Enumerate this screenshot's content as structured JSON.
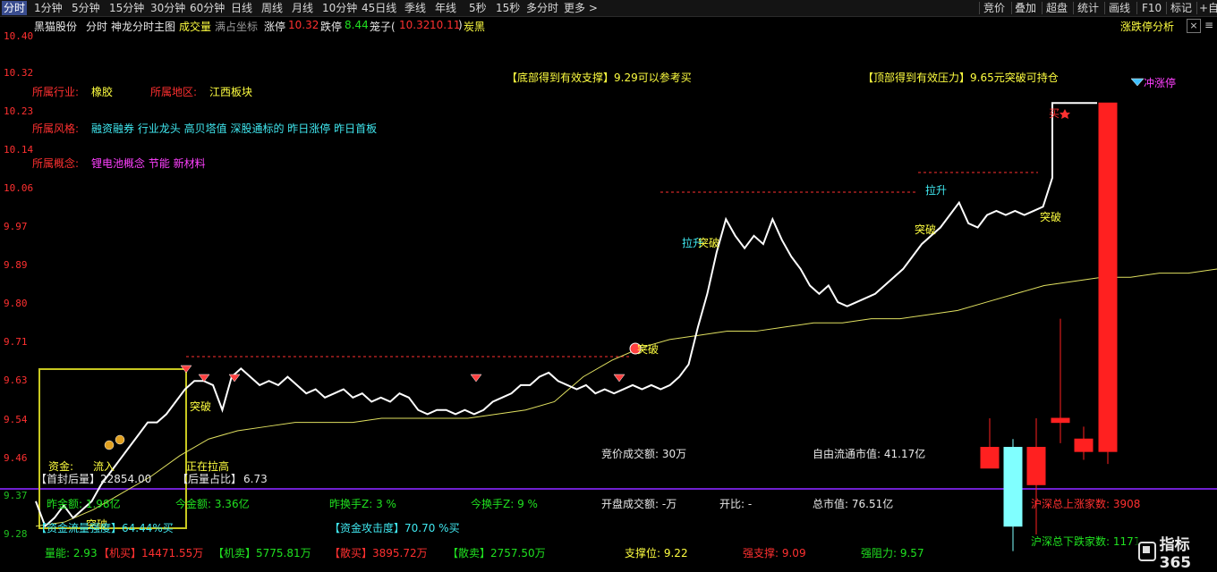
{
  "toolbar": {
    "timeframes": [
      "分时",
      "1分钟",
      "5分钟",
      "15分钟",
      "30分钟",
      "60分钟",
      "日线",
      "周线",
      "月线",
      "10分钟",
      "45日线",
      "季线",
      "年线",
      "5秒",
      "15秒",
      "多分时",
      "更多 >"
    ],
    "right_buttons": [
      "竞价",
      "叠加",
      "超盘",
      "统计",
      "画线",
      "F10",
      "标记",
      "+自"
    ]
  },
  "info": {
    "stock_name": "黑猫股份",
    "view": "分时",
    "indicator": "神龙分时主图",
    "volume": "成交量",
    "full_coord": "满占坐标",
    "limit_up_label": "涨停",
    "limit_up_value": "10.32",
    "limit_down_label": "跌停",
    "limit_down_value": "8.44",
    "cage_label": "笼子(",
    "cage_high": "10.32",
    "cage_low": "10.11",
    "cage_close": ")",
    "sector": "炭黑",
    "analysis_button": "涨跌停分析",
    "close_icon": "×",
    "menu_icon": "≡"
  },
  "axis": {
    "prices": [
      "10.40",
      "10.32",
      "10.23",
      "10.14",
      "10.06",
      "9.97",
      "9.89",
      "9.80",
      "9.71",
      "9.63",
      "9.54",
      "9.46",
      "9.37",
      "9.28"
    ]
  },
  "profile": {
    "industry_label": "所属行业:",
    "industry": "橡胶",
    "region_label": "所属地区:",
    "region": "江西板块",
    "style_label": "所属风格:",
    "style": "融资融券 行业龙头 高贝塔值 深股通标的 昨日涨停 昨日首板",
    "concept_label": "所属概念:",
    "concept": "锂电池概念 节能 新材料"
  },
  "annotations": {
    "support": "【底部得到有效支撑】9.29可以参考买",
    "resistance": "【顶部得到有效压力】9.65元突破可持仓",
    "limit_up": "冲涨停",
    "breakthrough": "突破",
    "pull_up": "拉升",
    "buy_mark": "买",
    "fund_label": "资金:",
    "fund_flow": "流入",
    "rising": "正在拉高"
  },
  "stats": {
    "first_seal": "【首封后量】22854.00",
    "after_ratio_label": "【后量占比】",
    "after_ratio": "6.73",
    "auction_amount": "竞价成交额: 30万",
    "float_mv": "自由流通市值: 41.17亿",
    "prev_amount": "昨金额: 1.98亿",
    "today_amount": "今金额: 3.36亿",
    "prev_turnover": "昨换手Z: 3 %",
    "today_turnover": "今换手Z: 9 %",
    "open_amount": "开盘成交额: -万",
    "open_ratio": "开比: -",
    "total_mv": "总市值: 76.51亿",
    "limit_up_count": "沪深总上涨家数: 3908",
    "fund_inflow": "【资金流量强度】64.44%买",
    "fund_attack": "【资金攻击度】70.70 %买",
    "limit_down_count": "沪深总下跌家数: 1171",
    "volume_ratio": "量能: 2.93",
    "inst_buy": "【机买】14471.55万",
    "inst_sell": "【机卖】5775.81万",
    "retail_buy": "【散买】3895.72万",
    "retail_sell": "【散卖】2757.50万",
    "support_level": "支撑位: 9.22",
    "strong_support": "强支撑: 9.09",
    "strong_resist": "强阻力: 9.57"
  },
  "footer": {
    "brand": "指标365"
  },
  "colors": {
    "up": "#ff3030",
    "down": "#20c020",
    "price_line": "#ffffff",
    "avg_line": "#e0e060",
    "box": "#c8c820",
    "purple_line": "#7020d0"
  },
  "chart_data": {
    "type": "line",
    "ylim": [
      9.28,
      10.4
    ],
    "series": [
      {
        "name": "price",
        "values": [
          9.36,
          9.3,
          9.32,
          9.35,
          9.32,
          9.34,
          9.36,
          9.4,
          9.43,
          9.46,
          9.49,
          9.52,
          9.55,
          9.55,
          9.57,
          9.6,
          9.63,
          9.65,
          9.65,
          9.64,
          9.58,
          9.66,
          9.68,
          9.66,
          9.64,
          9.65,
          9.64,
          9.66,
          9.64,
          9.62,
          9.63,
          9.61,
          9.62,
          9.63,
          9.61,
          9.62,
          9.6,
          9.61,
          9.6,
          9.62,
          9.61,
          9.58,
          9.57,
          9.58,
          9.58,
          9.57,
          9.58,
          9.57,
          9.58,
          9.6,
          9.61,
          9.62,
          9.64,
          9.64,
          9.66,
          9.67,
          9.65,
          9.64,
          9.63,
          9.64,
          9.62,
          9.63,
          9.62,
          9.63,
          9.64,
          9.63,
          9.64,
          9.63,
          9.64,
          9.66,
          9.69,
          9.78,
          9.86,
          9.96,
          10.04,
          10.0,
          9.97,
          10.0,
          9.98,
          10.04,
          9.99,
          9.95,
          9.92,
          9.88,
          9.86,
          9.88,
          9.84,
          9.83,
          9.84,
          9.85,
          9.86,
          9.88,
          9.9,
          9.92,
          9.95,
          9.98,
          10.0,
          10.02,
          10.05,
          10.08,
          10.03,
          10.02,
          10.05,
          10.06,
          10.05,
          10.06,
          10.05,
          10.06,
          10.07,
          10.14,
          10.32,
          10.32,
          10.32,
          10.32
        ]
      },
      {
        "name": "avg",
        "values": [
          9.3,
          9.31,
          9.34,
          9.38,
          9.42,
          9.47,
          9.51,
          9.53,
          9.54,
          9.55,
          9.55,
          9.55,
          9.56,
          9.56,
          9.56,
          9.56,
          9.57,
          9.58,
          9.6,
          9.66,
          9.7,
          9.73,
          9.75,
          9.76,
          9.77,
          9.77,
          9.78,
          9.79,
          9.79,
          9.8,
          9.8,
          9.81,
          9.82,
          9.84,
          9.86,
          9.88,
          9.89,
          9.9,
          9.9,
          9.91,
          9.91,
          9.92
        ]
      }
    ],
    "candles": [
      {
        "open": 9.49,
        "close": 9.44
      },
      {
        "open": 9.49,
        "close": 9.3
      },
      {
        "open": 9.4,
        "close": 9.49
      },
      {
        "open": 9.56,
        "close": 9.55
      },
      {
        "open": 9.48,
        "close": 9.51
      },
      {
        "open": 9.48,
        "close": 10.32
      }
    ]
  }
}
